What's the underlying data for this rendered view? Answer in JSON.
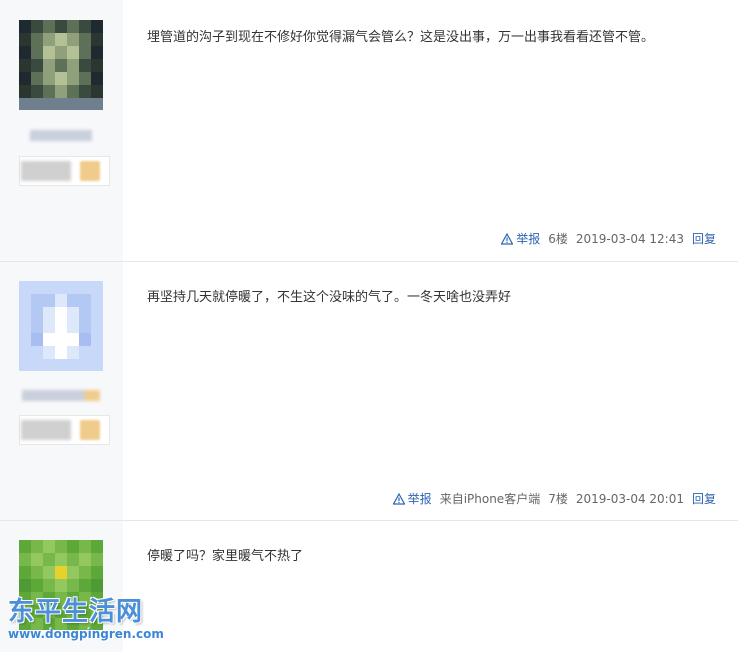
{
  "posts": [
    {
      "content": "埋管道的沟子到现在不修好你觉得漏气会管么？这是没出事，万一出事我看看还管不管。",
      "report_label": "举报",
      "client": "",
      "floor": "6楼",
      "time": "2019-03-04 12:43",
      "reply_label": "回复"
    },
    {
      "content": "再坚持几天就停暖了，不生这个没味的气了。一冬天啥也没弄好",
      "report_label": "举报",
      "client": "来自iPhone客户端",
      "floor": "7楼",
      "time": "2019-03-04 20:01",
      "reply_label": "回复"
    },
    {
      "content": "停暖了吗？家里暖气不热了"
    }
  ],
  "watermark": {
    "title": "东平生活网",
    "url": "www.dongpingren.com"
  },
  "colors": {
    "link": "#2d64b3",
    "meta": "#666666",
    "sidebar": "#f7f8fa",
    "watermark": "#4a8fd8"
  },
  "icons": {
    "report": "warning-triangle-icon"
  }
}
